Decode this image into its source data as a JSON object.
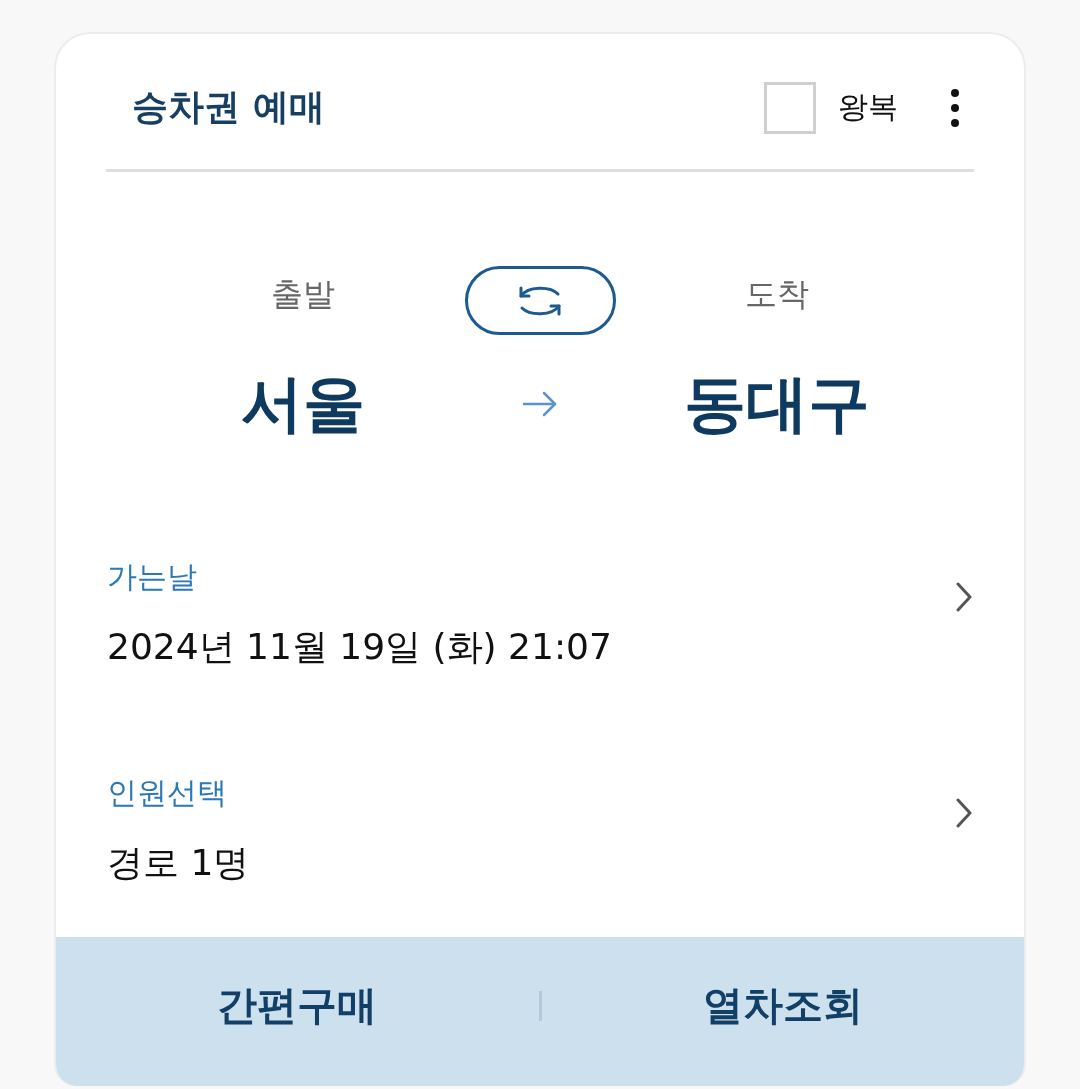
{
  "header": {
    "title": "승차권 예매",
    "round_trip": {
      "label": "왕복",
      "checked": false
    }
  },
  "route": {
    "departure": {
      "label": "출발",
      "station": "서울"
    },
    "arrival": {
      "label": "도착",
      "station": "동대구"
    }
  },
  "fields": [
    {
      "label": "가는날",
      "value": "2024년 11월 19일 (화) 21:07"
    },
    {
      "label": "인원선택",
      "value": "경로 1명"
    }
  ],
  "actions": [
    "간편구매",
    "열차조회"
  ]
}
